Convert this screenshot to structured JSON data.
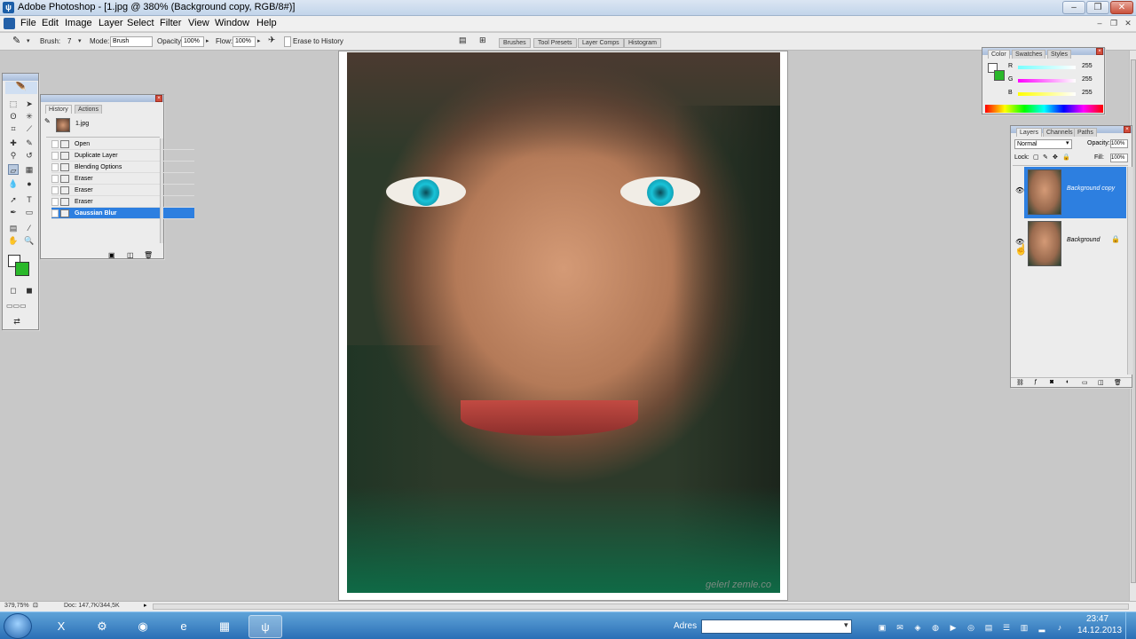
{
  "window": {
    "title": "Adobe Photoshop - [1.jpg @ 380% (Background copy, RGB/8#)]"
  },
  "menu": [
    "File",
    "Edit",
    "Image",
    "Layer",
    "Select",
    "Filter",
    "View",
    "Window",
    "Help"
  ],
  "options": {
    "brush_label": "Brush:",
    "brush_size": "7",
    "mode_label": "Mode:",
    "mode_value": "Brush",
    "opacity_label": "Opacity:",
    "opacity_value": "100%",
    "flow_label": "Flow:",
    "flow_value": "100%",
    "erase_label": "Erase to History"
  },
  "palette_well": [
    "Brushes",
    "Tool Presets",
    "Layer Comps",
    "Histogram"
  ],
  "history": {
    "tabs": [
      "History",
      "Actions"
    ],
    "snapshot": "1.jpg",
    "items": [
      "Open",
      "Duplicate Layer",
      "Blending Options",
      "Eraser",
      "Eraser",
      "Eraser",
      "Gaussian Blur"
    ],
    "selected_index": 6
  },
  "color": {
    "tabs": [
      "Color",
      "Swatches",
      "Styles"
    ],
    "channels": [
      {
        "name": "R",
        "value": "255"
      },
      {
        "name": "G",
        "value": "255"
      },
      {
        "name": "B",
        "value": "255"
      }
    ],
    "background_color": "#2ab82a"
  },
  "layers": {
    "tabs": [
      "Layers",
      "Channels",
      "Paths"
    ],
    "blend_mode": "Normal",
    "opacity_label": "Opacity:",
    "opacity": "100%",
    "lock_label": "Lock:",
    "fill_label": "Fill:",
    "fill": "100%",
    "items": [
      {
        "name": "Background copy",
        "selected": true
      },
      {
        "name": "Background",
        "selected": false
      }
    ]
  },
  "canvas": {
    "watermark": "gelerl zemle.co"
  },
  "status": {
    "zoom": "379,75%",
    "doc": "Doc: 147,7K/344,5K"
  },
  "taskbar": {
    "adres_label": "Adres",
    "time": "23:47",
    "date": "14.12.2013"
  }
}
